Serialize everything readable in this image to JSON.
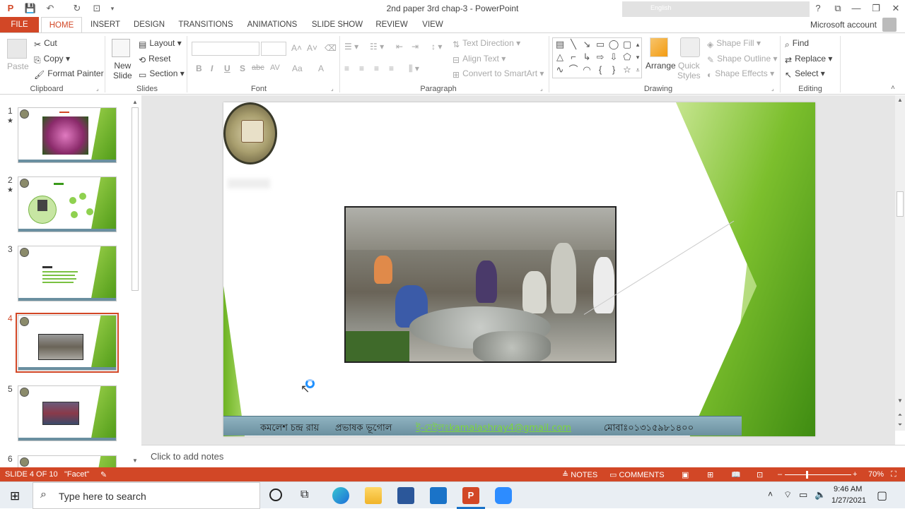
{
  "window": {
    "title": "2nd paper 3rd chap-3 - PowerPoint",
    "language_indicator": "English",
    "help": "?",
    "minimize": "—",
    "restore": "❐",
    "close": "✕"
  },
  "tabs": [
    "FILE",
    "HOME",
    "INSERT",
    "DESIGN",
    "TRANSITIONS",
    "ANIMATIONS",
    "SLIDE SHOW",
    "REVIEW",
    "VIEW"
  ],
  "account": "Microsoft account",
  "ribbon": {
    "clipboard": {
      "label": "Clipboard",
      "paste": "Paste",
      "cut": "Cut",
      "copy": "Copy",
      "format_painter": "Format Painter"
    },
    "slides": {
      "label": "Slides",
      "new_slide_1": "New",
      "new_slide_2": "Slide",
      "layout": "Layout",
      "reset": "Reset",
      "section": "Section"
    },
    "font": {
      "label": "Font",
      "bold": "B",
      "italic": "I",
      "underline": "U",
      "shadow": "S",
      "strike": "abc",
      "spacing": "AV",
      "case": "Aa",
      "color": "A"
    },
    "paragraph": {
      "label": "Paragraph",
      "text_direction": "Text Direction",
      "align_text": "Align Text",
      "convert_smartart": "Convert to SmartArt"
    },
    "drawing": {
      "label": "Drawing",
      "arrange": "Arrange",
      "quick_styles_1": "Quick",
      "quick_styles_2": "Styles",
      "shape_fill": "Shape Fill",
      "shape_outline": "Shape Outline",
      "shape_effects": "Shape Effects"
    },
    "editing": {
      "label": "Editing",
      "find": "Find",
      "replace": "Replace",
      "select": "Select"
    }
  },
  "thumbnails": [
    {
      "num": "1",
      "star": "★"
    },
    {
      "num": "2",
      "star": "★"
    },
    {
      "num": "3",
      "star": ""
    },
    {
      "num": "4",
      "star": ""
    },
    {
      "num": "5",
      "star": ""
    },
    {
      "num": "6",
      "star": ""
    }
  ],
  "slide": {
    "footer_name": "কমলেশ চন্দ্র রায়",
    "footer_role": "প্রভাষক ভূগোল",
    "footer_email": "ই-মেইলঃkamalashray4@gmail.com",
    "footer_phone": "মোবাঃ০১৩১৫৯৮১৪০০"
  },
  "notes_placeholder": "Click to add notes",
  "status": {
    "slide_info": "SLIDE 4 OF 10",
    "theme": "\"Facet\"",
    "notes": "NOTES",
    "comments": "COMMENTS",
    "zoom": "70%"
  },
  "taskbar": {
    "search_placeholder": "Type here to search",
    "time": "9:46 AM",
    "date": "1/27/2021"
  },
  "colors": {
    "accent": "#d24726",
    "footer_email": "#7dd83a",
    "slide_green": "#7cbf2d"
  }
}
